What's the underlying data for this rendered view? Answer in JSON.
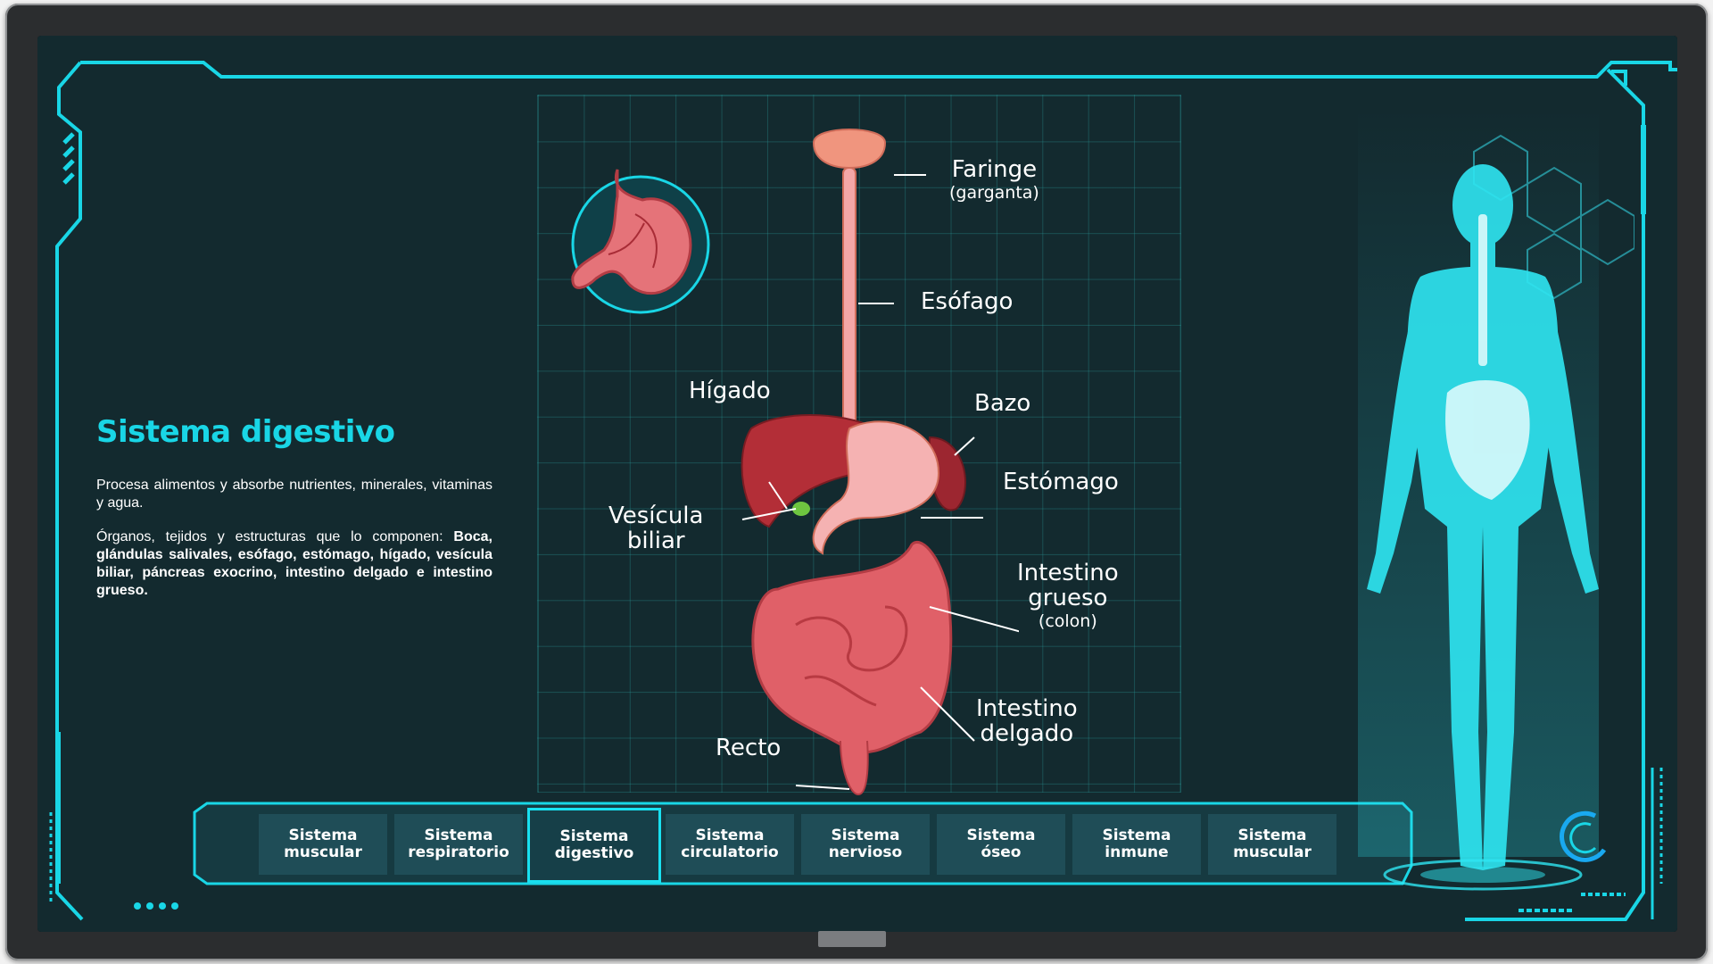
{
  "panel": {
    "title": "Sistema digestivo",
    "description": "Procesa alimentos y absorbe nutrientes, minerales, vitaminas y agua.",
    "organs_intro": "Órganos, tejidos y estructuras que lo componen: ",
    "organs_list": "Boca, glándulas salivales, esófago, estómago, hígado, vesícula biliar, páncreas exocrino, intestino delgado e intestino grueso."
  },
  "labels": {
    "faringe": "Faringe",
    "faringe_sub": "(garganta)",
    "esofago": "Esófago",
    "higado": "Hígado",
    "bazo": "Bazo",
    "estomago": "Estómago",
    "vesicula_1": "Vesícula",
    "vesicula_2": "biliar",
    "grueso_1": "Intestino",
    "grueso_2": "grueso",
    "grueso_sub": "(colon)",
    "delgado_1": "Intestino",
    "delgado_2": "delgado",
    "recto": "Recto"
  },
  "tabs": [
    {
      "line1": "Sistema",
      "line2": "muscular",
      "active": false
    },
    {
      "line1": "Sistema",
      "line2": "respiratorio",
      "active": false
    },
    {
      "line1": "Sistema",
      "line2": "digestivo",
      "active": true
    },
    {
      "line1": "Sistema",
      "line2": "circulatorio",
      "active": false
    },
    {
      "line1": "Sistema",
      "line2": "nervioso",
      "active": false
    },
    {
      "line1": "Sistema",
      "line2": "óseo",
      "active": false
    },
    {
      "line1": "Sistema",
      "line2": "inmune",
      "active": false
    },
    {
      "line1": "Sistema",
      "line2": "muscular",
      "active": false
    }
  ],
  "colors": {
    "accent": "#19d6e6",
    "panel_bg": "#132a2f",
    "tab_bg": "#1f4d57",
    "organ": "#d9535a",
    "hologram": "#2fe6f2"
  },
  "icons": {
    "stomach_badge": "stomach-icon",
    "hologram": "human-body-hologram",
    "loader": "loading-ring-icon"
  }
}
